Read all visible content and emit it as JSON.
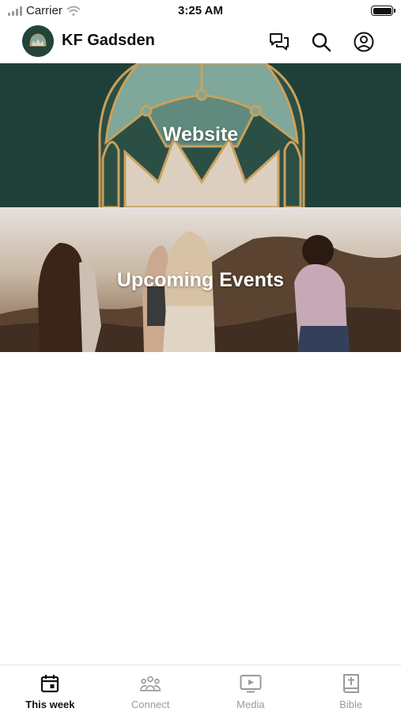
{
  "status_bar": {
    "carrier": "Carrier",
    "time": "3:25 AM"
  },
  "header": {
    "title": "KF Gadsden",
    "icons": [
      "chat-icon",
      "search-icon",
      "profile-icon"
    ]
  },
  "cards": [
    {
      "label": "Website"
    },
    {
      "label": "Upcoming Events"
    }
  ],
  "tabbar": {
    "tabs": [
      {
        "label": "This week",
        "icon": "calendar-icon",
        "active": true
      },
      {
        "label": "Connect",
        "icon": "people-icon",
        "active": false
      },
      {
        "label": "Media",
        "icon": "play-screen-icon",
        "active": false
      },
      {
        "label": "Bible",
        "icon": "bible-icon",
        "active": false
      }
    ]
  },
  "colors": {
    "brand_dark_green": "#1f4038",
    "window_teal": "#7fa79a",
    "frame_gold": "#c9a15d",
    "crown_cream": "#dccfbf",
    "active_tab": "#111111",
    "inactive_tab": "#9a9a9a"
  }
}
